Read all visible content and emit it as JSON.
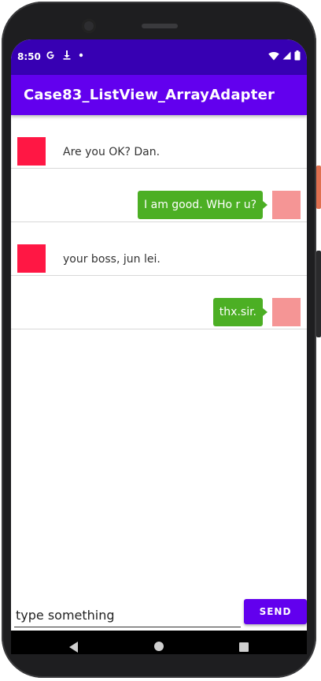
{
  "status_bar": {
    "time": "8:50",
    "left_icons": [
      "google-g-icon",
      "download-icon",
      "dot-icon"
    ],
    "right_icons": [
      "wifi-icon",
      "signal-icon",
      "battery-icon"
    ]
  },
  "app_bar": {
    "title": "Case83_ListView_ArrayAdapter"
  },
  "messages": [
    {
      "side": "left",
      "text": "Are you OK? Dan."
    },
    {
      "side": "right",
      "text": "I am good. WHo r u?"
    },
    {
      "side": "left",
      "text": "your boss, jun lei."
    },
    {
      "side": "right",
      "text": "thx.sir."
    }
  ],
  "composer": {
    "value": "",
    "placeholder": "type something",
    "send_label": "SEND"
  },
  "navigation": {
    "icons": [
      "back-icon",
      "home-icon",
      "recents-icon"
    ]
  },
  "colors": {
    "status_bar": "#3700b3",
    "app_bar": "#6200ee",
    "bubble_right": "#4caf24",
    "avatar_left": "#ff1744",
    "avatar_right": "#f59595"
  }
}
